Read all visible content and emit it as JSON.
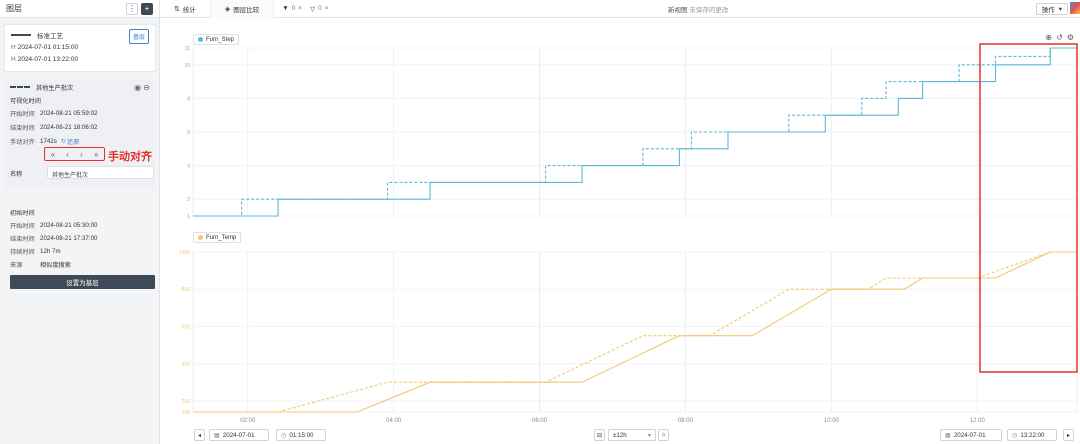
{
  "left": {
    "title": "图层",
    "baseline": {
      "name": "标准工艺",
      "badge": "基层",
      "start": "2024-07-01 01:15:00",
      "end": "2024-07-01 13:22:00",
      "start_prefix": "H",
      "end_prefix": "H"
    },
    "layer": {
      "name": "其他生产批次",
      "visible_time": "可视化时间",
      "start_label": "开始时间",
      "start": "2024-08-21 05:59:02",
      "end_label": "结束时间",
      "end": "2024-08-21 18:06:02",
      "align_label": "手动对齐",
      "align_value": "1742s",
      "restore": "还原",
      "annotation": "手动对齐",
      "name_label": "名称",
      "name_value": "其他生产批次"
    },
    "info": {
      "initial_time": "初始时间",
      "start_label": "开始时间",
      "start": "2024-08-21 05:30:00",
      "end_label": "结束时间",
      "end": "2024-08-21 17:37:00",
      "duration_label": "持续时间",
      "duration": "12h 7m",
      "source_label": "来源",
      "source": "相似度搜索",
      "set_base": "设置为基层"
    }
  },
  "topbar": {
    "tab1": "统计",
    "tab2": "图层比较",
    "filter1_count": "0",
    "filter2_count": "0",
    "title": "新视图",
    "subtitle": "未保存的更改",
    "ops": "操作"
  },
  "bottom": {
    "start_date": "2024-07-01",
    "start_time": "01:15:00",
    "range": "±12h",
    "end_date": "2024-07-01",
    "end_time": "13:22:00"
  },
  "chart_data": [
    {
      "type": "line",
      "title": "Furn_Step",
      "x_ticks": [
        "02:00",
        "04:00",
        "06:00",
        "08:00",
        "10:00",
        "12:00"
      ],
      "y_ticks": [
        1,
        2,
        4,
        6,
        8,
        10,
        11
      ],
      "ylim": [
        1,
        11
      ],
      "color": "#5bb8d8",
      "series": [
        {
          "style": "solid",
          "x": [
            "01:15",
            "02:25",
            "02:25",
            "04:30",
            "04:30",
            "06:35",
            "06:35",
            "07:55",
            "07:55",
            "08:35",
            "08:35",
            "09:55",
            "09:55",
            "10:55",
            "10:55",
            "11:15",
            "11:15",
            "12:15",
            "12:15",
            "13:00",
            "13:00",
            "13:22"
          ],
          "values": [
            1,
            1,
            2,
            2,
            3,
            3,
            4,
            4,
            5,
            5,
            6,
            6,
            7,
            7,
            8,
            8,
            9,
            9,
            10,
            10,
            11,
            11
          ]
        },
        {
          "style": "dashed",
          "x": [
            "01:15",
            "01:55",
            "01:55",
            "03:55",
            "03:55",
            "06:05",
            "06:05",
            "07:25",
            "07:25",
            "08:05",
            "08:05",
            "09:25",
            "09:25",
            "10:25",
            "10:25",
            "10:45",
            "10:45",
            "11:45",
            "11:45",
            "12:15",
            "12:15",
            "13:00",
            "13:00",
            "13:22"
          ],
          "values": [
            1,
            1,
            2,
            2,
            3,
            3,
            4,
            4,
            5,
            5,
            6,
            6,
            7,
            7,
            8,
            8,
            9,
            9,
            10,
            10,
            10.5,
            10.5,
            11,
            11
          ]
        }
      ]
    },
    {
      "type": "line",
      "title": "Furn_Temp",
      "x_ticks": [
        "02:00",
        "04:00",
        "06:00",
        "08:00",
        "10:00",
        "12:00"
      ],
      "y_ticks": [
        140,
        200,
        400,
        600,
        800,
        1000
      ],
      "ylim": [
        140,
        1000
      ],
      "color": "#f0c870",
      "series": [
        {
          "style": "solid",
          "x": [
            "01:15",
            "03:30",
            "04:30",
            "06:35",
            "07:55",
            "08:55",
            "10:00",
            "11:00",
            "11:15",
            "12:15",
            "13:00",
            "13:22"
          ],
          "values": [
            140,
            140,
            300,
            300,
            550,
            550,
            800,
            800,
            860,
            860,
            1000,
            1000
          ]
        },
        {
          "style": "dashed",
          "x": [
            "01:15",
            "02:25",
            "03:55",
            "06:05",
            "07:25",
            "08:20",
            "09:25",
            "10:30",
            "10:45",
            "12:00",
            "13:00",
            "13:22"
          ],
          "values": [
            140,
            140,
            300,
            300,
            550,
            550,
            800,
            800,
            860,
            860,
            1000,
            1000
          ]
        }
      ]
    }
  ]
}
